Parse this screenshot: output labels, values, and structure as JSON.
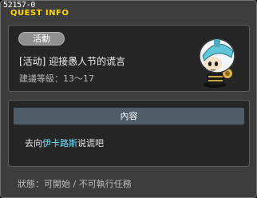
{
  "window": {
    "quest_id": "52157-0",
    "title": "QUEST INFO"
  },
  "quest": {
    "category_badge": "活動",
    "name": "[活动] 迎接愚人节的谎言",
    "level_requirement": "建議等級：13～17"
  },
  "content": {
    "header": "內容",
    "prefix": "去向",
    "npc_name": "伊卡路斯",
    "suffix": "说谎吧"
  },
  "status": {
    "text": "狀態：可開始 / 不可執行任務"
  },
  "icons": {
    "npc_portrait": "ikarus-npc-icon"
  },
  "colors": {
    "title": "#ffd700",
    "npc_highlight": "#6fe0ff",
    "header_bar": "#4f5d69"
  }
}
